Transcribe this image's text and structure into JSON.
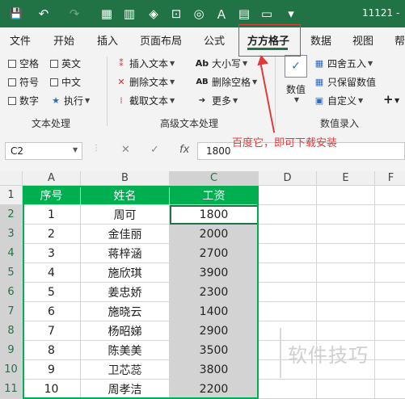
{
  "title_bar": {
    "doc_title": "11121 -",
    "icons": [
      "save-icon",
      "undo-icon",
      "redo-icon",
      "form-icon",
      "chart-icon",
      "fill-icon",
      "capture-icon",
      "shape-icon",
      "text-icon",
      "table-icon",
      "window-icon",
      "more-icon"
    ]
  },
  "tabs": [
    "文件",
    "开始",
    "插入",
    "页面布局",
    "公式",
    "方方格子",
    "数据",
    "视图",
    "帮"
  ],
  "active_tab": "方方格子",
  "ribbon": {
    "text_group": {
      "items": [
        "空格",
        "英文",
        "符号",
        "中文",
        "数字",
        "执行"
      ],
      "label": "文本处理"
    },
    "advanced_group": {
      "items": [
        "插入文本",
        "删除文本",
        "截取文本",
        "大小写",
        "删除空格",
        "更多"
      ],
      "label": "高级文本处理"
    },
    "numeric_group": {
      "big_button": "数值",
      "items": [
        "四舍五入",
        "只保留数值",
        "自定义"
      ],
      "plus": "+",
      "label": "数值录入"
    }
  },
  "formula_bar": {
    "name_box": "C2",
    "cancel": "✕",
    "confirm": "✓",
    "fx": "fx",
    "value": "1800"
  },
  "annotation": "百度它，即可下载安装",
  "sheet": {
    "columns": [
      "A",
      "B",
      "C",
      "D",
      "E",
      "F"
    ],
    "rows": [
      "1",
      "2",
      "3",
      "4",
      "5",
      "6",
      "7",
      "8",
      "9",
      "10",
      "11"
    ],
    "headers": [
      "序号",
      "姓名",
      "工资"
    ],
    "data": [
      [
        "1",
        "周可",
        "1800"
      ],
      [
        "2",
        "金佳丽",
        "2000"
      ],
      [
        "3",
        "蒋梓涵",
        "2700"
      ],
      [
        "4",
        "施欣琪",
        "3900"
      ],
      [
        "5",
        "姜忠娇",
        "2300"
      ],
      [
        "6",
        "施晓云",
        "1400"
      ],
      [
        "7",
        "杨昭娣",
        "2900"
      ],
      [
        "8",
        "陈美美",
        "3500"
      ],
      [
        "9",
        "卫芯蕊",
        "3800"
      ],
      [
        "10",
        "周孝洁",
        "2200"
      ]
    ]
  },
  "watermark": "软件技巧"
}
